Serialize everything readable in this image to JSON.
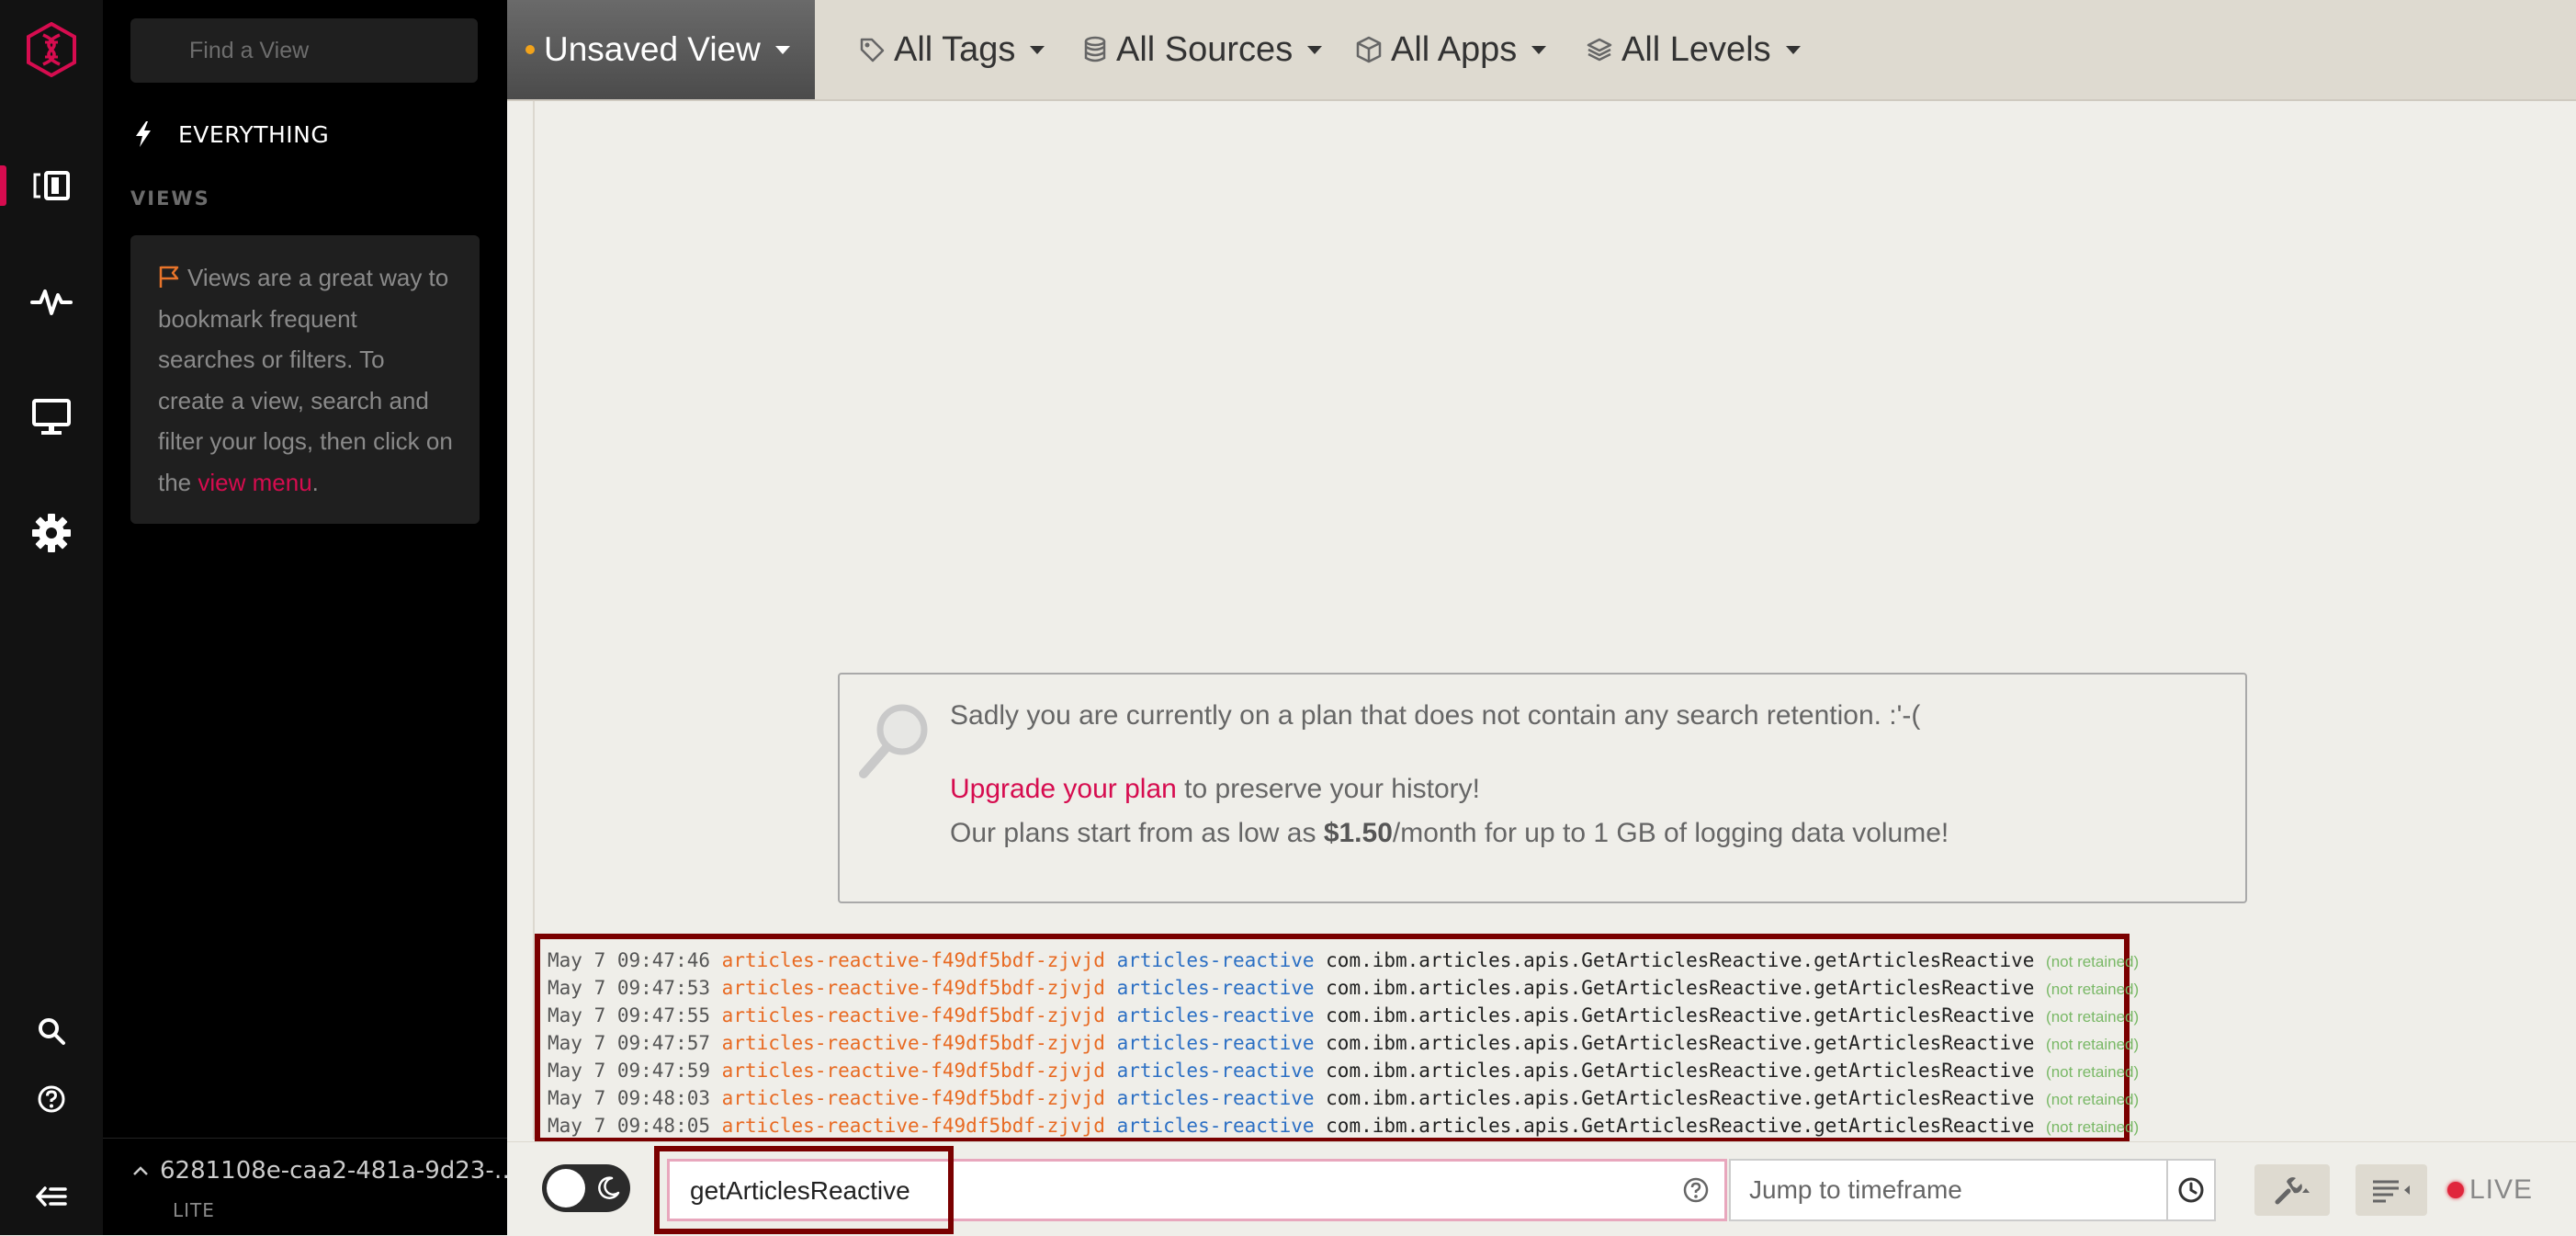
{
  "app": {
    "brand_color": "#d60c4f"
  },
  "rail": {
    "icons": [
      "logo-icon",
      "views-icon",
      "activity-icon",
      "monitor-icon",
      "settings-icon",
      "search-icon",
      "help-icon",
      "collapse-icon"
    ]
  },
  "sidebar": {
    "find_placeholder": "Find a View",
    "everything_label": "EVERYTHING",
    "views_heading": "VIEWS",
    "views_info": {
      "before": "Views are a great way to bookmark frequent searches or filters. To create a view, search and filter your logs, then click on the ",
      "link": "view menu",
      "after": "."
    },
    "account_id": "6281108e-caa2-481a-9d23-…",
    "account_tier": "LITE"
  },
  "topbar": {
    "view_name": "Unsaved View",
    "filters": [
      {
        "label": "All Tags",
        "icon": "tag-icon"
      },
      {
        "label": "All Sources",
        "icon": "database-icon"
      },
      {
        "label": "All Apps",
        "icon": "cube-icon"
      },
      {
        "label": "All Levels",
        "icon": "layers-icon"
      }
    ]
  },
  "notice": {
    "line1": "Sadly you are currently on a plan that does not contain any search retention. :'-(",
    "upgrade_link": "Upgrade your plan",
    "upgrade_rest": " to preserve your history!",
    "price_before": "Our plans start from as low as ",
    "price": "$1.50",
    "price_after": "/month for up to 1 GB of logging data volume!"
  },
  "logs": [
    {
      "ts": "May 7 09:47:46",
      "pod": "articles-reactive-f49df5bdf-zjvjd",
      "app": "articles-reactive",
      "msg": "com.ibm.articles.apis.GetArticlesReactive.getArticlesReactive",
      "note": "(not retained)"
    },
    {
      "ts": "May 7 09:47:53",
      "pod": "articles-reactive-f49df5bdf-zjvjd",
      "app": "articles-reactive",
      "msg": "com.ibm.articles.apis.GetArticlesReactive.getArticlesReactive",
      "note": "(not retained)"
    },
    {
      "ts": "May 7 09:47:55",
      "pod": "articles-reactive-f49df5bdf-zjvjd",
      "app": "articles-reactive",
      "msg": "com.ibm.articles.apis.GetArticlesReactive.getArticlesReactive",
      "note": "(not retained)"
    },
    {
      "ts": "May 7 09:47:57",
      "pod": "articles-reactive-f49df5bdf-zjvjd",
      "app": "articles-reactive",
      "msg": "com.ibm.articles.apis.GetArticlesReactive.getArticlesReactive",
      "note": "(not retained)"
    },
    {
      "ts": "May 7 09:47:59",
      "pod": "articles-reactive-f49df5bdf-zjvjd",
      "app": "articles-reactive",
      "msg": "com.ibm.articles.apis.GetArticlesReactive.getArticlesReactive",
      "note": "(not retained)"
    },
    {
      "ts": "May 7 09:48:03",
      "pod": "articles-reactive-f49df5bdf-zjvjd",
      "app": "articles-reactive",
      "msg": "com.ibm.articles.apis.GetArticlesReactive.getArticlesReactive",
      "note": "(not retained)"
    },
    {
      "ts": "May 7 09:48:05",
      "pod": "articles-reactive-f49df5bdf-zjvjd",
      "app": "articles-reactive",
      "msg": "com.ibm.articles.apis.GetArticlesReactive.getArticlesReactive",
      "note": "(not retained)"
    }
  ],
  "bottombar": {
    "search_value": "getArticlesReactive",
    "jump_placeholder": "Jump to timeframe",
    "live_label": "LIVE"
  }
}
